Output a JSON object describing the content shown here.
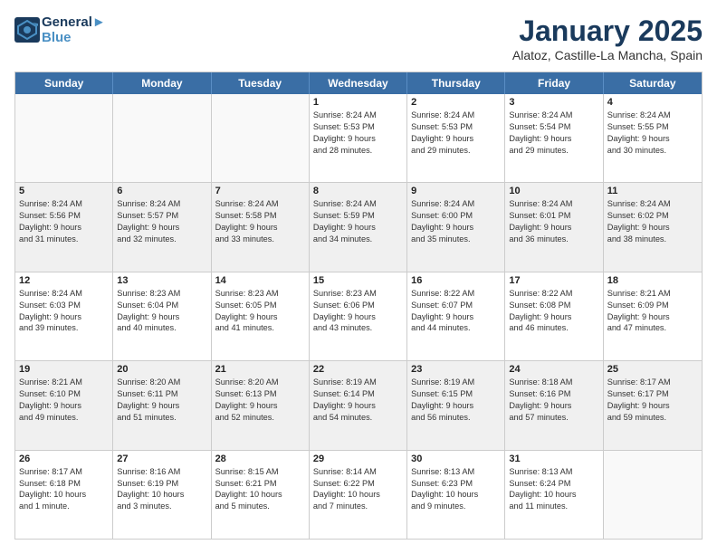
{
  "logo": {
    "line1": "General",
    "line2": "Blue"
  },
  "title": "January 2025",
  "subtitle": "Alatoz, Castille-La Mancha, Spain",
  "days_of_week": [
    "Sunday",
    "Monday",
    "Tuesday",
    "Wednesday",
    "Thursday",
    "Friday",
    "Saturday"
  ],
  "weeks": [
    [
      {
        "day": "",
        "text": ""
      },
      {
        "day": "",
        "text": ""
      },
      {
        "day": "",
        "text": ""
      },
      {
        "day": "1",
        "text": "Sunrise: 8:24 AM\nSunset: 5:53 PM\nDaylight: 9 hours\nand 28 minutes."
      },
      {
        "day": "2",
        "text": "Sunrise: 8:24 AM\nSunset: 5:53 PM\nDaylight: 9 hours\nand 29 minutes."
      },
      {
        "day": "3",
        "text": "Sunrise: 8:24 AM\nSunset: 5:54 PM\nDaylight: 9 hours\nand 29 minutes."
      },
      {
        "day": "4",
        "text": "Sunrise: 8:24 AM\nSunset: 5:55 PM\nDaylight: 9 hours\nand 30 minutes."
      }
    ],
    [
      {
        "day": "5",
        "text": "Sunrise: 8:24 AM\nSunset: 5:56 PM\nDaylight: 9 hours\nand 31 minutes."
      },
      {
        "day": "6",
        "text": "Sunrise: 8:24 AM\nSunset: 5:57 PM\nDaylight: 9 hours\nand 32 minutes."
      },
      {
        "day": "7",
        "text": "Sunrise: 8:24 AM\nSunset: 5:58 PM\nDaylight: 9 hours\nand 33 minutes."
      },
      {
        "day": "8",
        "text": "Sunrise: 8:24 AM\nSunset: 5:59 PM\nDaylight: 9 hours\nand 34 minutes."
      },
      {
        "day": "9",
        "text": "Sunrise: 8:24 AM\nSunset: 6:00 PM\nDaylight: 9 hours\nand 35 minutes."
      },
      {
        "day": "10",
        "text": "Sunrise: 8:24 AM\nSunset: 6:01 PM\nDaylight: 9 hours\nand 36 minutes."
      },
      {
        "day": "11",
        "text": "Sunrise: 8:24 AM\nSunset: 6:02 PM\nDaylight: 9 hours\nand 38 minutes."
      }
    ],
    [
      {
        "day": "12",
        "text": "Sunrise: 8:24 AM\nSunset: 6:03 PM\nDaylight: 9 hours\nand 39 minutes."
      },
      {
        "day": "13",
        "text": "Sunrise: 8:23 AM\nSunset: 6:04 PM\nDaylight: 9 hours\nand 40 minutes."
      },
      {
        "day": "14",
        "text": "Sunrise: 8:23 AM\nSunset: 6:05 PM\nDaylight: 9 hours\nand 41 minutes."
      },
      {
        "day": "15",
        "text": "Sunrise: 8:23 AM\nSunset: 6:06 PM\nDaylight: 9 hours\nand 43 minutes."
      },
      {
        "day": "16",
        "text": "Sunrise: 8:22 AM\nSunset: 6:07 PM\nDaylight: 9 hours\nand 44 minutes."
      },
      {
        "day": "17",
        "text": "Sunrise: 8:22 AM\nSunset: 6:08 PM\nDaylight: 9 hours\nand 46 minutes."
      },
      {
        "day": "18",
        "text": "Sunrise: 8:21 AM\nSunset: 6:09 PM\nDaylight: 9 hours\nand 47 minutes."
      }
    ],
    [
      {
        "day": "19",
        "text": "Sunrise: 8:21 AM\nSunset: 6:10 PM\nDaylight: 9 hours\nand 49 minutes."
      },
      {
        "day": "20",
        "text": "Sunrise: 8:20 AM\nSunset: 6:11 PM\nDaylight: 9 hours\nand 51 minutes."
      },
      {
        "day": "21",
        "text": "Sunrise: 8:20 AM\nSunset: 6:13 PM\nDaylight: 9 hours\nand 52 minutes."
      },
      {
        "day": "22",
        "text": "Sunrise: 8:19 AM\nSunset: 6:14 PM\nDaylight: 9 hours\nand 54 minutes."
      },
      {
        "day": "23",
        "text": "Sunrise: 8:19 AM\nSunset: 6:15 PM\nDaylight: 9 hours\nand 56 minutes."
      },
      {
        "day": "24",
        "text": "Sunrise: 8:18 AM\nSunset: 6:16 PM\nDaylight: 9 hours\nand 57 minutes."
      },
      {
        "day": "25",
        "text": "Sunrise: 8:17 AM\nSunset: 6:17 PM\nDaylight: 9 hours\nand 59 minutes."
      }
    ],
    [
      {
        "day": "26",
        "text": "Sunrise: 8:17 AM\nSunset: 6:18 PM\nDaylight: 10 hours\nand 1 minute."
      },
      {
        "day": "27",
        "text": "Sunrise: 8:16 AM\nSunset: 6:19 PM\nDaylight: 10 hours\nand 3 minutes."
      },
      {
        "day": "28",
        "text": "Sunrise: 8:15 AM\nSunset: 6:21 PM\nDaylight: 10 hours\nand 5 minutes."
      },
      {
        "day": "29",
        "text": "Sunrise: 8:14 AM\nSunset: 6:22 PM\nDaylight: 10 hours\nand 7 minutes."
      },
      {
        "day": "30",
        "text": "Sunrise: 8:13 AM\nSunset: 6:23 PM\nDaylight: 10 hours\nand 9 minutes."
      },
      {
        "day": "31",
        "text": "Sunrise: 8:13 AM\nSunset: 6:24 PM\nDaylight: 10 hours\nand 11 minutes."
      },
      {
        "day": "",
        "text": ""
      }
    ]
  ]
}
